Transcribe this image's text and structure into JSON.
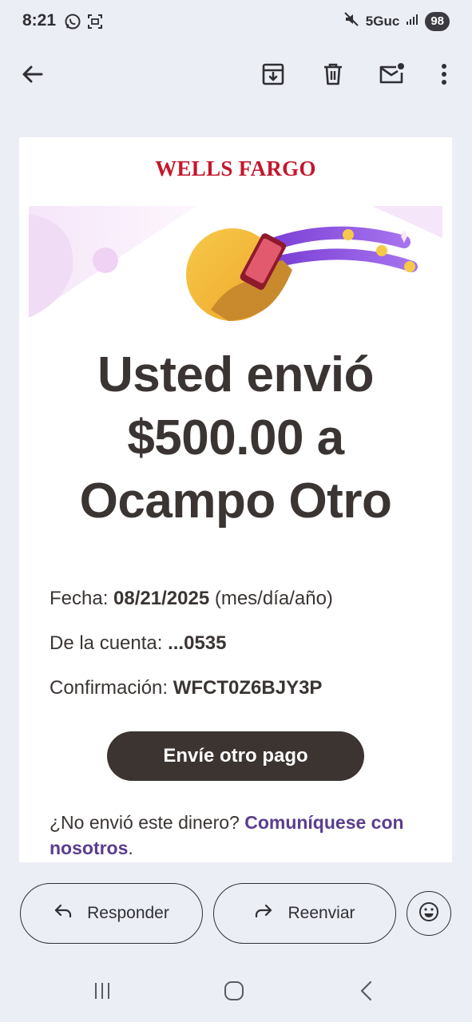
{
  "status_bar": {
    "time": "8:21",
    "network": "5Guc",
    "battery": "98"
  },
  "email": {
    "brand": "WELLS FARGO",
    "headline": "Usted envió\n$500.00 a\nOcampo Otro",
    "details": [
      {
        "label": "Fecha: ",
        "value": "08/21/2025",
        "suffix": " (mes/día/año)"
      },
      {
        "label": "De la cuenta: ",
        "value": "...0535",
        "suffix": ""
      },
      {
        "label": "Confirmación: ",
        "value": "WFCT0Z6BJY3P",
        "suffix": ""
      }
    ],
    "button_label": "Envíe otro pago",
    "footer_text": "¿No envió este dinero? ",
    "footer_link": "Comuníquese con nosotros",
    "footer_end": "."
  },
  "actions": {
    "reply_label": "Responder",
    "forward_label": "Reenviar"
  },
  "colors": {
    "brand_red": "#c4172c",
    "button_dark": "#3b3431",
    "link_purple": "#5a3e8c",
    "background": "#eceef5"
  },
  "icons": [
    "whatsapp-icon",
    "screenshot-icon",
    "mute-icon",
    "signal-icon",
    "back-arrow-icon",
    "archive-icon",
    "delete-icon",
    "mark-unread-icon",
    "more-vert-icon",
    "reply-icon",
    "forward-icon",
    "emoji-icon",
    "recents-icon",
    "home-icon",
    "nav-back-icon"
  ]
}
